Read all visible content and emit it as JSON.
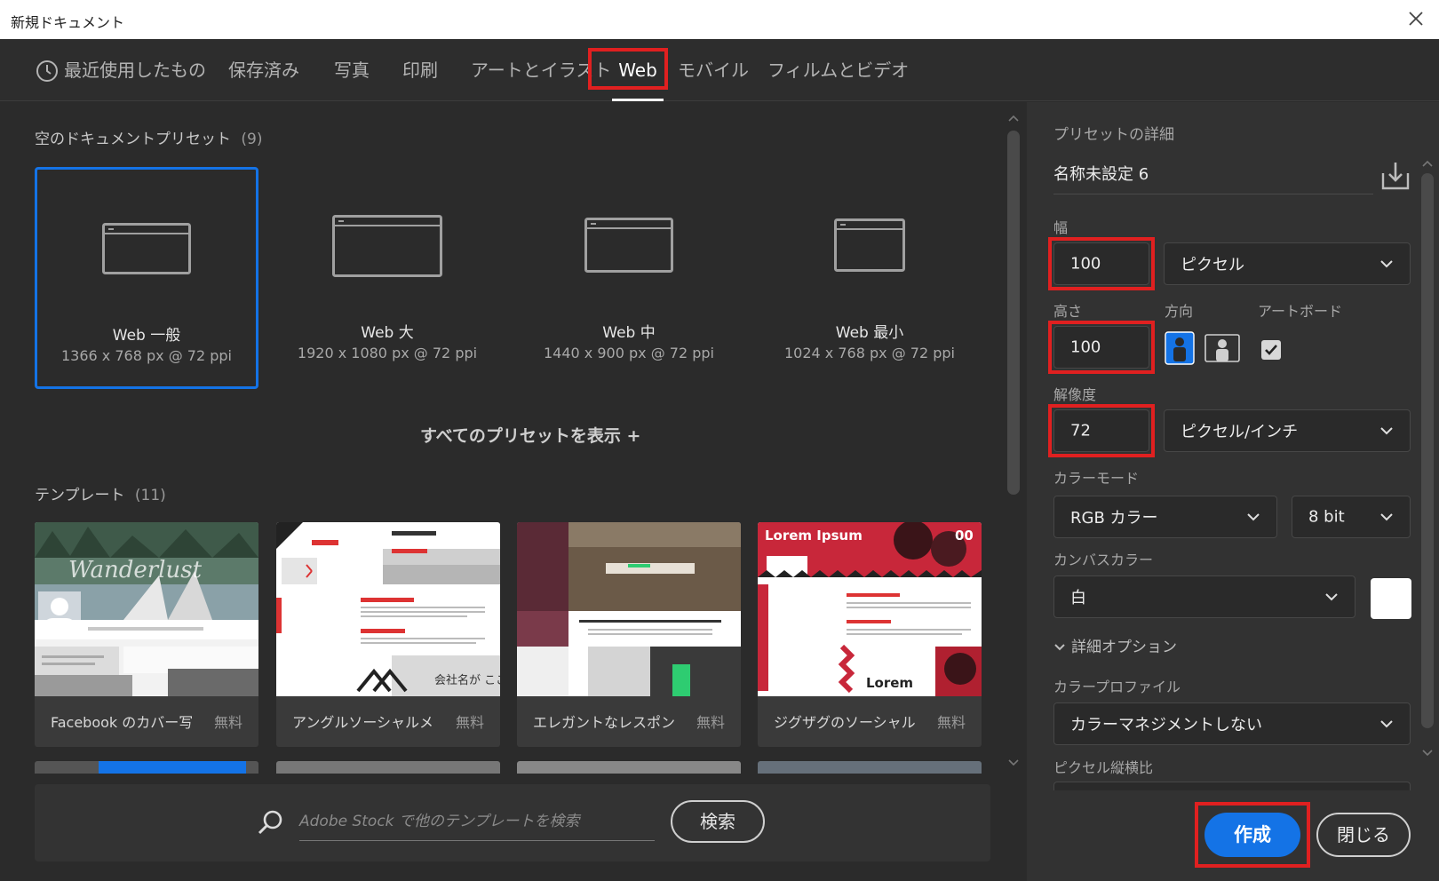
{
  "window": {
    "title": "新規ドキュメント"
  },
  "tabs": [
    {
      "label": "最近使用したもの"
    },
    {
      "label": "保存済み"
    },
    {
      "label": "写真"
    },
    {
      "label": "印刷"
    },
    {
      "label": "アートとイラスト"
    },
    {
      "label": "Web",
      "active": true
    },
    {
      "label": "モバイル"
    },
    {
      "label": "フィルムとビデオ"
    }
  ],
  "presets": {
    "heading": "空のドキュメントプリセット",
    "count": "(9)",
    "items": [
      {
        "name": "Web 一般",
        "dims": "1366 x 768 px @ 72 ppi",
        "selected": true
      },
      {
        "name": "Web 大",
        "dims": "1920 x 1080 px @ 72 ppi"
      },
      {
        "name": "Web 中",
        "dims": "1440 x 900 px @ 72 ppi"
      },
      {
        "name": "Web 最小",
        "dims": "1024 x 768 px @ 72 ppi"
      }
    ],
    "show_all": "すべてのプリセットを表示 +"
  },
  "templates": {
    "heading": "テンプレート",
    "count": "(11)",
    "items": [
      {
        "name": "Facebook のカバー写...",
        "price": "無料",
        "thumb_text": "Wanderlust"
      },
      {
        "name": "アングルソーシャルメデ...",
        "price": "無料",
        "thumb_text": "会社名が ここに"
      },
      {
        "name": "エレガントなレスポンシ...",
        "price": "無料",
        "thumb_text": ""
      },
      {
        "name": "ジグザグのソーシャルメ...",
        "price": "無料",
        "thumb_text": "Lorem Ipsum"
      }
    ]
  },
  "search": {
    "placeholder": "Adobe Stock で他のテンプレートを検索",
    "button": "検索"
  },
  "details": {
    "heading": "プリセットの詳細",
    "preset_name": "名称未設定 6",
    "width_label": "幅",
    "width": "100",
    "width_unit": "ピクセル",
    "height_label": "高さ",
    "height": "100",
    "orientation_label": "方向",
    "artboard_label": "アートボード",
    "artboard_checked": true,
    "resolution_label": "解像度",
    "resolution": "72",
    "resolution_unit": "ピクセル/インチ",
    "color_mode_label": "カラーモード",
    "color_mode": "RGB カラー",
    "bit_depth": "8 bit",
    "canvas_label": "カンバスカラー",
    "canvas_color": "白",
    "canvas_swatch": "#ffffff",
    "advanced": "詳細オプション",
    "profile_label": "カラープロファイル",
    "profile": "カラーマネジメントしない",
    "pixel_aspect_label": "ピクセル縦横比"
  },
  "actions": {
    "create": "作成",
    "close": "閉じる"
  },
  "colors": {
    "accent": "#1473e6",
    "highlight": "#e02020",
    "bg": "#2b2b2b",
    "panel": "#323232"
  }
}
